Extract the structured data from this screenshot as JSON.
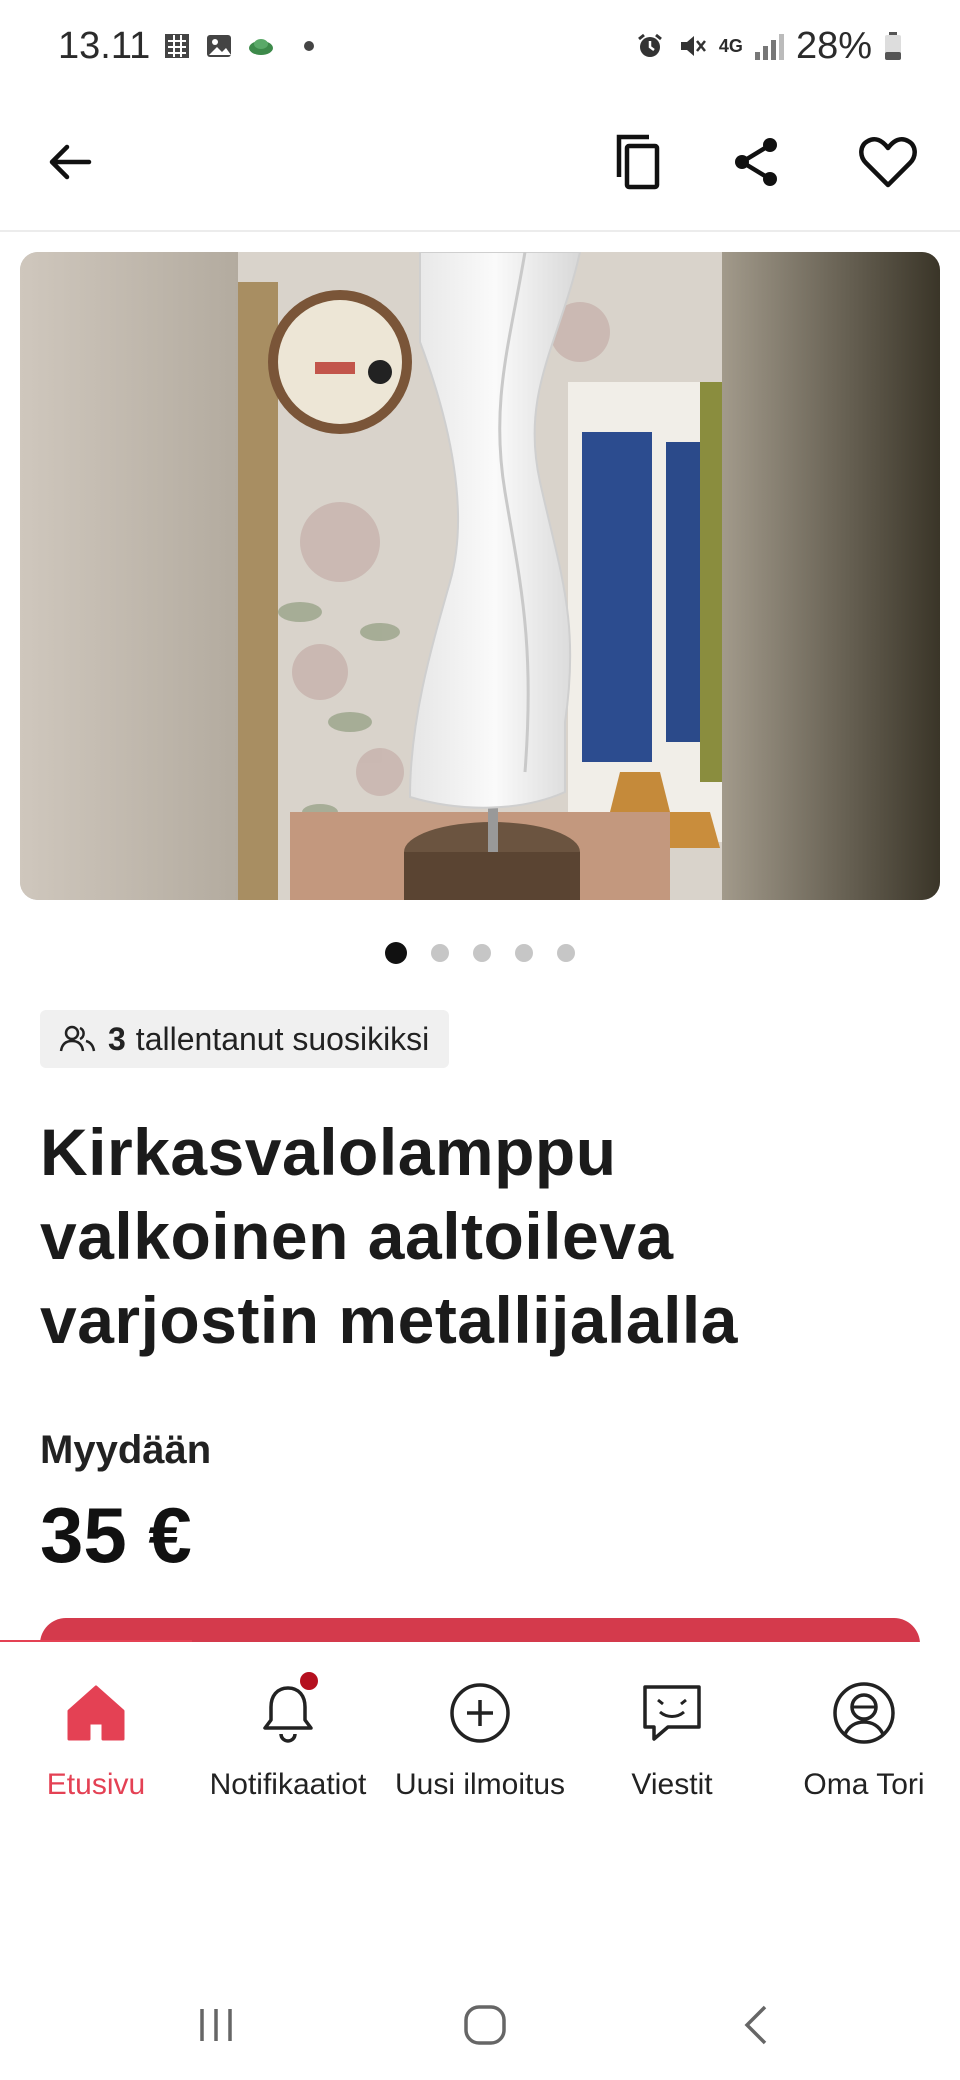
{
  "status_bar": {
    "time": "13.11",
    "battery": "28%",
    "network": "4G"
  },
  "app_bar": {
    "icons": [
      "arrow-back-icon",
      "copy-icon",
      "share-icon",
      "heart-icon"
    ]
  },
  "gallery": {
    "image_count": 5,
    "active_index": 0
  },
  "listing": {
    "favorites_count": "3",
    "favorites_text": "tallentanut suosikiksi",
    "title": "Kirkasvalolamppu valkoinen aaltoileva varjostin metallijalalla",
    "sale_type": "Myydään",
    "price": "35 €"
  },
  "bottom_nav": {
    "items": [
      {
        "label": "Etusivu",
        "icon": "home-icon",
        "active": true
      },
      {
        "label": "Notifikaatiot",
        "icon": "bell-icon",
        "active": false
      },
      {
        "label": "Uusi ilmoitus",
        "icon": "plus-circle-icon",
        "active": false
      },
      {
        "label": "Viestit",
        "icon": "chat-icon",
        "active": false
      },
      {
        "label": "Oma Tori",
        "icon": "profile-icon",
        "active": false
      }
    ]
  },
  "colors": {
    "accent": "#e44154",
    "cta": "#d43a4c",
    "notification_dot": "#b5101f"
  }
}
